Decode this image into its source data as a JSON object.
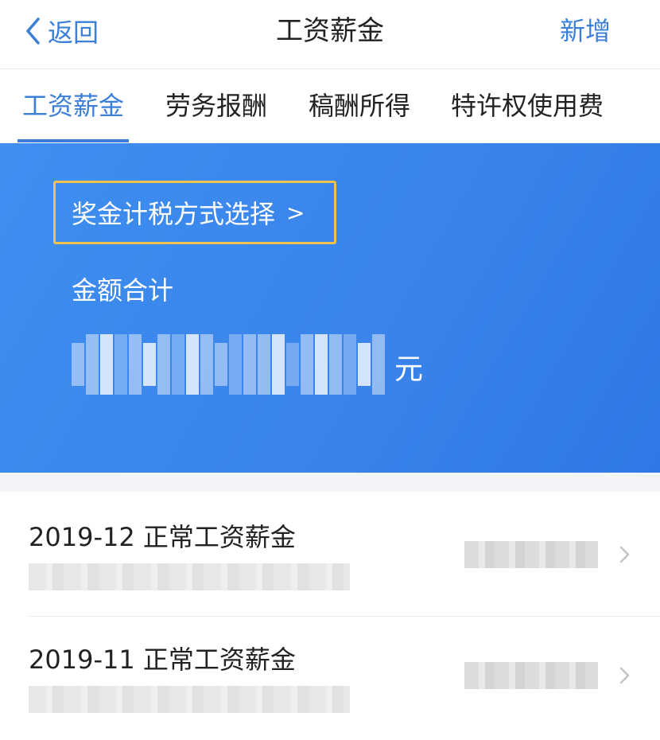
{
  "header": {
    "back_label": "返回",
    "title": "工资薪金",
    "add_label": "新增"
  },
  "tabs": [
    {
      "label": "工资薪金",
      "active": true
    },
    {
      "label": "劳务报酬",
      "active": false
    },
    {
      "label": "稿酬所得",
      "active": false
    },
    {
      "label": "特许权使用费",
      "active": false
    }
  ],
  "summary": {
    "bonus_tax_method_label": "奖金计税方式选择",
    "bonus_arrow": ">",
    "total_label": "金额合计",
    "total_value_obscured": true,
    "unit": "元"
  },
  "records": [
    {
      "title": "2019-12 正常工资薪金",
      "detail_obscured": true,
      "amount_obscured": true
    },
    {
      "title": "2019-11 正常工资薪金",
      "detail_obscured": true,
      "amount_obscured": true
    }
  ],
  "colors": {
    "accent": "#3b7fd9",
    "card_bg": "#3a84ea",
    "highlight_border": "#f2c34b",
    "text": "#222222"
  },
  "icons": {
    "back": "chevron-left-icon",
    "row_arrow": "chevron-right-icon"
  }
}
